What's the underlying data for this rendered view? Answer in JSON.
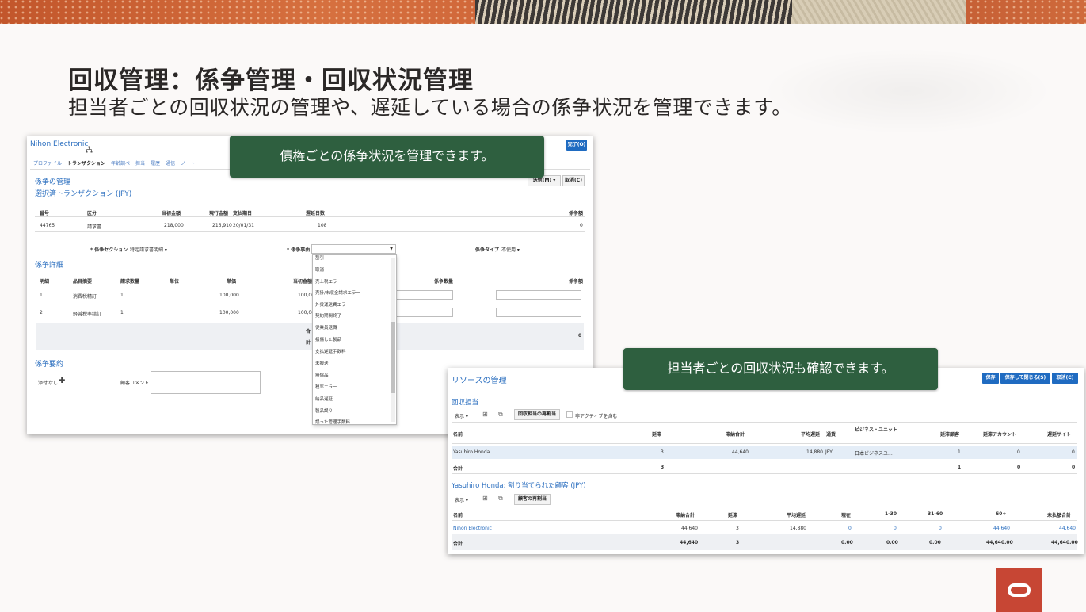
{
  "slide": {
    "title": "回収管理：係争管理・回収状況管理",
    "subtitle": "担当者ごとの回収状況の管理や、遅延している場合の係争状況を管理できます。"
  },
  "callouts": {
    "dispute": "債権ごとの係争状況を管理できます。",
    "status": "担当者ごとの回収状況も確認できます。"
  },
  "dispute_panel": {
    "customer": "Nihon Electronic",
    "done_button": "完了(O)",
    "tabs": [
      "プロファイル",
      "トランザクション",
      "年齢調べ",
      "担当",
      "履歴",
      "通信",
      "ノート"
    ],
    "section_title": "係争の管理",
    "subsection": "選択済トランザクション (JPY)",
    "send_button": "送信(M)",
    "cancel_button": "取消(C)",
    "tx_headers": [
      "番号",
      "区分",
      "当初金額",
      "現行金額",
      "支払期日",
      "遅延日数",
      "係争額"
    ],
    "tx_row": [
      "44765",
      "請求書",
      "218,000",
      "216,910",
      "20/01/31",
      "108",
      "0"
    ],
    "dispute_section_label": "* 係争セクション",
    "dispute_section_value": "特定請求書明細",
    "dispute_reason_label": "* 係争事由",
    "dispute_type_label": "係争タイプ",
    "dispute_type_value": "不使用",
    "detail_title": "係争詳細",
    "detail_headers": [
      "明細",
      "品目摘要",
      "請求数量",
      "単位",
      "単価",
      "当初金額",
      "係争数量",
      "係争額"
    ],
    "detail_rows": [
      [
        "1",
        "消費税精訂",
        "1",
        "",
        "100,000",
        "100,000"
      ],
      [
        "2",
        "軽減税率精訂",
        "1",
        "",
        "100,000",
        "100,000"
      ]
    ],
    "totals_fragment": [
      "合",
      "計"
    ],
    "totals_value": "0",
    "summary_title": "係争要約",
    "attach_label": "添付",
    "attach_value": "なし",
    "comment_label": "顧客コメント",
    "reasons": [
      "割引",
      "取消",
      "売上税エラー",
      "売掛/未収金請求エラー",
      "外貨運送費エラー",
      "契約期間終了",
      "従業員退職",
      "損傷した製品",
      "支払遅延手数料",
      "未搬送",
      "無償品",
      "税率エラー",
      "納品遅延",
      "製品誤り",
      "誤った管理手数料"
    ]
  },
  "resource_panel": {
    "title": "リソースの管理",
    "save_button": "保存",
    "save_close_button": "保存して閉じる(S)",
    "cancel_button": "取消(C)",
    "collector_title": "回収担当",
    "view_label": "表示",
    "reassign_collector_button": "回収担当の再割当",
    "inactive_checkbox": "非アクティブを含む",
    "collector_headers": [
      "名前",
      "延滞",
      "滞納合計",
      "平均遅延",
      "通貨",
      "ビジネス・ユニット",
      "延滞顧客",
      "延滞アカウント",
      "遅延サイト"
    ],
    "collector_row": [
      "Yasuhiro Honda",
      "3",
      "44,640",
      "14,880",
      "JPY",
      "日本ビジネスユ...",
      "1",
      "0",
      "0"
    ],
    "collector_total": [
      "合計",
      "3",
      "",
      "",
      "",
      "",
      "1",
      "0",
      "0"
    ],
    "customer_title": "Yasuhiro Honda: 割り当てられた顧客 (JPY)",
    "reassign_customer_button": "顧客の再割当",
    "customer_headers": [
      "名前",
      "滞納合計",
      "延滞",
      "平均遅延",
      "現在",
      "1-30",
      "31-60",
      "60+",
      "未払額合計"
    ],
    "customer_row": [
      "Nihon Electronic",
      "44,640",
      "3",
      "14,880",
      "0",
      "0",
      "0",
      "44,640",
      "44,640"
    ],
    "customer_total": [
      "合計",
      "44,640",
      "3",
      "",
      "0.00",
      "0.00",
      "0.00",
      "44,640.00",
      "44,640.00"
    ]
  },
  "icons": [
    "hierarchy-icon",
    "chevron-down-icon",
    "plus-icon",
    "freeze-icon",
    "detach-icon",
    "oracle-logo-icon"
  ],
  "colors": {
    "accent_blue": "#1f6bc1",
    "callout_green": "#2e5f3f",
    "oracle_red": "#c74634"
  }
}
